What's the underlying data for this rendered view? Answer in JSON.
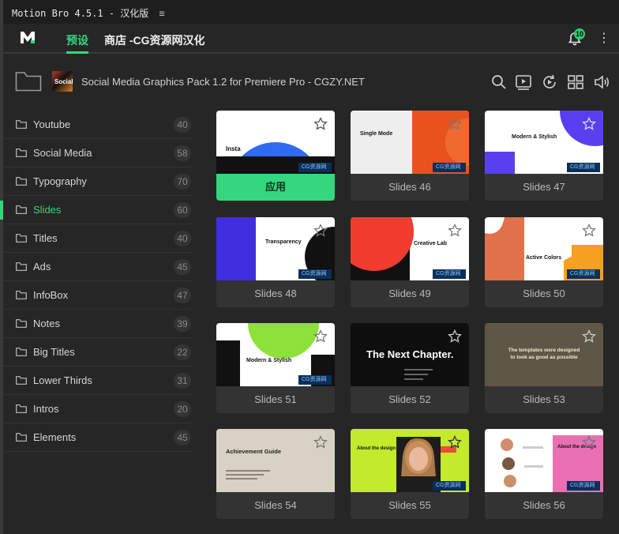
{
  "titlebar": {
    "title": "Motion Bro 4.5.1 - 汉化版",
    "menu_glyph": "≡"
  },
  "topbar": {
    "tab_presets": "预设",
    "tab_store": "商店 -CG资源网汉化",
    "notification_count": "10",
    "more_glyph": "⋮"
  },
  "pack": {
    "title": "Social Media Graphics Pack 1.2 for Premiere Pro - CGZY.NET",
    "thumb_text": "Social"
  },
  "sidebar": {
    "items": [
      {
        "label": "Youtube",
        "count": "40"
      },
      {
        "label": "Social Media",
        "count": "58"
      },
      {
        "label": "Typography",
        "count": "70"
      },
      {
        "label": "Slides",
        "count": "60"
      },
      {
        "label": "Titles",
        "count": "40"
      },
      {
        "label": "Ads",
        "count": "45"
      },
      {
        "label": "InfoBox",
        "count": "47"
      },
      {
        "label": "Notes",
        "count": "39"
      },
      {
        "label": "Big Titles",
        "count": "22"
      },
      {
        "label": "Lower Thirds",
        "count": "31"
      },
      {
        "label": "Intros",
        "count": "20"
      },
      {
        "label": "Elements",
        "count": "45"
      }
    ]
  },
  "watermark": "CG资源网",
  "cards": [
    {
      "label": "应用",
      "thumb_text": "Insta"
    },
    {
      "label": "Slides 46",
      "thumb_text": "Single Mode"
    },
    {
      "label": "Slides 47",
      "thumb_text": "Modern & Stylish"
    },
    {
      "label": "Slides 48",
      "thumb_text": "Transparency"
    },
    {
      "label": "Slides 49",
      "thumb_text": "Creative Lab"
    },
    {
      "label": "Slides 50",
      "thumb_text": "Active Colors"
    },
    {
      "label": "Slides 51",
      "thumb_text": "Modern & Stylish"
    },
    {
      "label": "Slides 52",
      "thumb_text": "The Next Chapter."
    },
    {
      "label": "Slides 53",
      "thumb_text": "The templates were designed to look as good as possible"
    },
    {
      "label": "Slides 54",
      "thumb_text": "Achievement Guide"
    },
    {
      "label": "Slides 55",
      "thumb_text": "About the design"
    },
    {
      "label": "Slides 56",
      "thumb_text": "About the design"
    }
  ],
  "colors": {
    "accent": "#35d67e",
    "background": "#262626"
  }
}
